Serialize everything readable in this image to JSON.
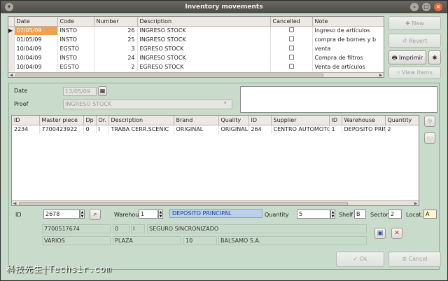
{
  "window": {
    "title": "Inventory movements"
  },
  "movements_table": {
    "columns": [
      "Date",
      "Code",
      "Number",
      "Description",
      "Cancelled",
      "Note"
    ],
    "rows": [
      {
        "date": "07/05/09",
        "code": "INSTO",
        "number": "26",
        "description": "INGRESO STOCK",
        "note": "Ingreso de artículos"
      },
      {
        "date": "01/05/09",
        "code": "INSTO",
        "number": "25",
        "description": "INGRESO STOCK",
        "note": "compra de bornes y b"
      },
      {
        "date": "10/04/09",
        "code": "EGSTO",
        "number": "3",
        "description": "EGRESO STOCK",
        "note": "venta"
      },
      {
        "date": "10/04/09",
        "code": "INSTO",
        "number": "24",
        "description": "INGRESO STOCK",
        "note": "Compra de filtros"
      },
      {
        "date": "10/04/09",
        "code": "EGSTO",
        "number": "2",
        "description": "EGRESO STOCK",
        "note": "Venta de artículos"
      }
    ]
  },
  "side_buttons": {
    "new": "New",
    "revert": "Revert",
    "print": "Imprimir",
    "view_items": "View items"
  },
  "form": {
    "date_label": "Date",
    "date_value": "13/05/09",
    "proof_label": "Proof",
    "proof_value": "INGRESO STOCK"
  },
  "items_table": {
    "columns": [
      "ID",
      "Master piece",
      "Dp",
      "Or.",
      "Description",
      "Brand",
      "Quality",
      "ID",
      "Supplier",
      "ID",
      "Warehouse",
      "Quantity"
    ],
    "rows": [
      {
        "id": "2234",
        "master": "7700423922",
        "dp": "0",
        "or": "I",
        "description": "TRABA CERR.SCENIC",
        "brand": "ORIGINAL",
        "quality": "ORIGINAL",
        "id2": "264",
        "supplier": "CENTRO AUTOMOTO",
        "id3": "1",
        "warehouse": "DEPOSITO PRIN",
        "quantity": "2"
      }
    ]
  },
  "detail": {
    "id_label": "ID",
    "id_value": "2678",
    "warehouse_label": "Warehou",
    "warehouse_value": "1",
    "warehouse_name": "DEPOSITO PRINCIPAL",
    "quantity_label": "Quantity",
    "quantity_value": "5",
    "shelf_label": "Shelf",
    "shelf_value": "B",
    "sector_label": "Sector",
    "sector_value": "2",
    "locat_label": "Locat.",
    "locat_value": "A",
    "row1": {
      "master": "7700517674",
      "dp": "0",
      "or": "I",
      "description": "SEGURO SINCRONIZADO"
    },
    "row2": {
      "brand": "VARIOS",
      "quality": "PLAZA",
      "supplier_id": "10",
      "supplier": "BALSAMO S.A."
    }
  },
  "footer": {
    "ok": "Ok",
    "cancel": "Cancel"
  },
  "watermark": "科技先生|Techsir.com"
}
